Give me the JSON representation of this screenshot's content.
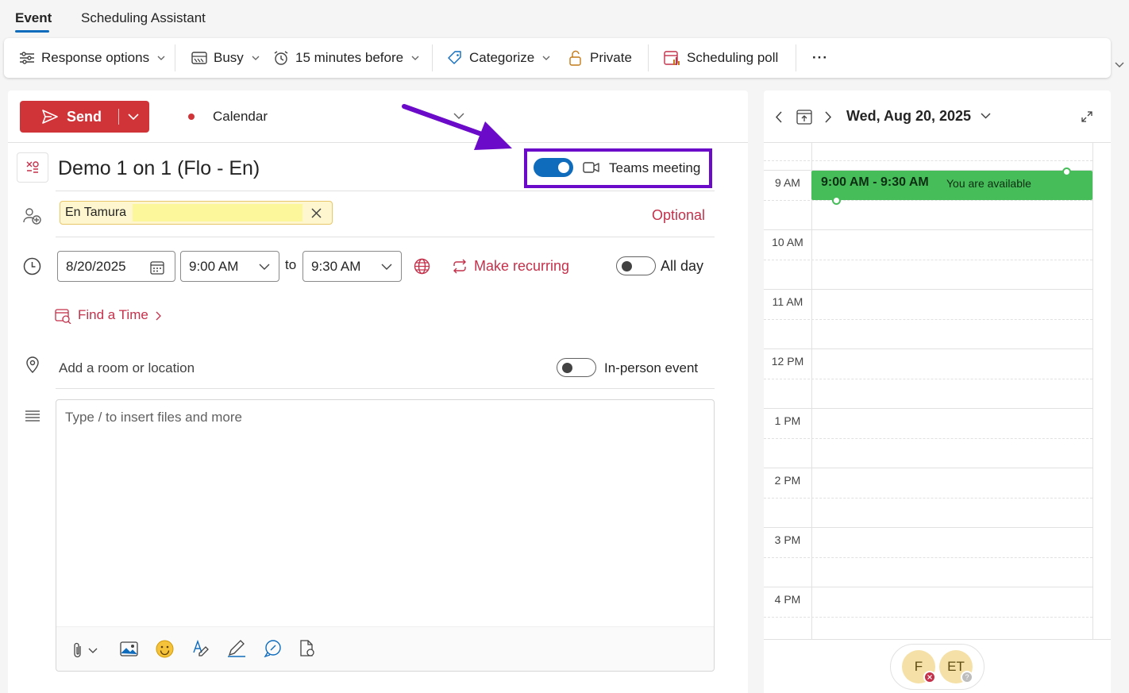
{
  "tabs": [
    {
      "label": "Event",
      "active": true
    },
    {
      "label": "Scheduling Assistant",
      "active": false
    }
  ],
  "ribbon": {
    "response_options": "Response options",
    "busy": "Busy",
    "reminder": "15 minutes before",
    "categorize": "Categorize",
    "private": "Private",
    "scheduling_poll": "Scheduling poll",
    "more": "···"
  },
  "compose": {
    "send_label": "Send",
    "calendar_label": "Calendar",
    "title": "Demo 1 on 1 (Flo - En)",
    "teams_label": "Teams meeting",
    "teams_on": true,
    "attendee": "En Tamura",
    "optional_label": "Optional",
    "start_date": "8/20/2025",
    "start_time": "9:00 AM",
    "to_label": "to",
    "end_time": "9:30 AM",
    "recurring_label": "Make recurring",
    "all_day_label": "All day",
    "find_time_label": "Find a Time",
    "location_placeholder": "Add a room or location",
    "in_person_label": "In-person event",
    "body_placeholder": "Type / to insert files and more"
  },
  "calendar": {
    "date_label": "Wed, Aug 20, 2025",
    "hours": [
      "9 AM",
      "10 AM",
      "11 AM",
      "12 PM",
      "1 PM",
      "2 PM",
      "3 PM",
      "4 PM"
    ],
    "event_time": "9:00 AM - 9:30 AM",
    "event_status": "You are available",
    "event_color": "#47bd5a"
  },
  "attendees": [
    {
      "initials": "F",
      "status": "declined"
    },
    {
      "initials": "ET",
      "status": "unknown"
    }
  ],
  "colors": {
    "accent": "#0f6cbd",
    "send": "#d13438",
    "link_red": "#c4314b",
    "annotation": "#6b0ac9"
  }
}
